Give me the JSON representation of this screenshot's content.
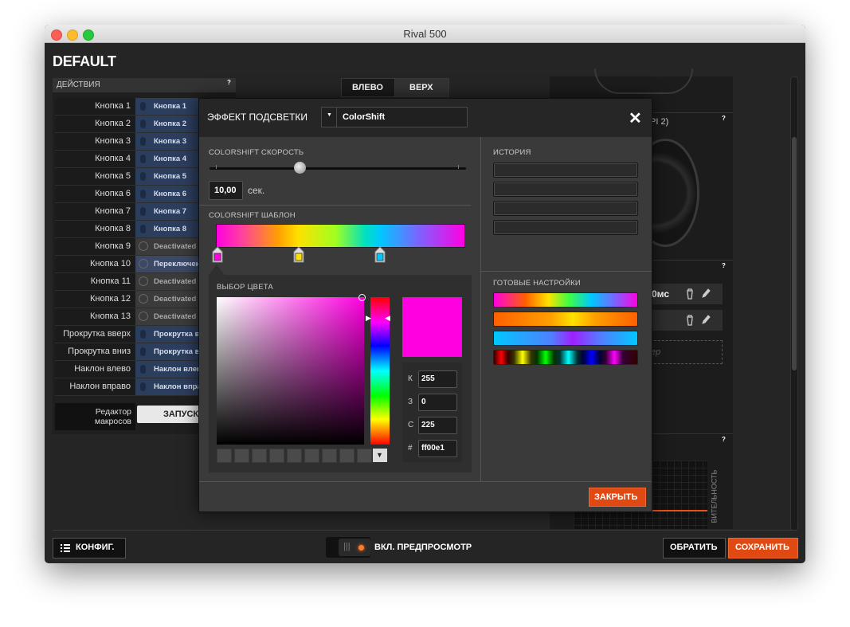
{
  "window": {
    "title": "Rival 500"
  },
  "profile": {
    "name": "DEFAULT"
  },
  "actions": {
    "header": "ДЕЙСТВИЯ",
    "help": "?",
    "rows": [
      {
        "name": "Кнопка 1",
        "value": "Кнопка 1",
        "kind": "mouse"
      },
      {
        "name": "Кнопка 2",
        "value": "Кнопка 2",
        "kind": "mouse"
      },
      {
        "name": "Кнопка 3",
        "value": "Кнопка 3",
        "kind": "mouse"
      },
      {
        "name": "Кнопка 4",
        "value": "Кнопка 4",
        "kind": "mouse"
      },
      {
        "name": "Кнопка 5",
        "value": "Кнопка 5",
        "kind": "mouse"
      },
      {
        "name": "Кнопка 6",
        "value": "Кнопка 6",
        "kind": "mouse"
      },
      {
        "name": "Кнопка 7",
        "value": "Кнопка 7",
        "kind": "mouse"
      },
      {
        "name": "Кнопка 8",
        "value": "Кнопка 8",
        "kind": "mouse"
      },
      {
        "name": "Кнопка 9",
        "value": "Deactivated",
        "kind": "off"
      },
      {
        "name": "Кнопка 10",
        "value": "Переключен",
        "kind": "switch"
      },
      {
        "name": "Кнопка 11",
        "value": "Deactivated",
        "kind": "off"
      },
      {
        "name": "Кнопка 12",
        "value": "Deactivated",
        "kind": "off"
      },
      {
        "name": "Кнопка 13",
        "value": "Deactivated",
        "kind": "off"
      },
      {
        "name": "Прокрутка вверх",
        "value": "Прокрутка в",
        "kind": "mouse"
      },
      {
        "name": "Прокрутка вниз",
        "value": "Прокрутка в",
        "kind": "mouse"
      },
      {
        "name": "Наклон влево",
        "value": "Наклон влев",
        "kind": "mouse"
      },
      {
        "name": "Наклон вправо",
        "value": "Наклон впра",
        "kind": "mouse"
      }
    ],
    "macro_editor": "Редактор макросов",
    "macro_launch": "ЗАПУСК"
  },
  "view_tabs": [
    "ВЛЕВО",
    "ВЕРХ"
  ],
  "background": {
    "dpi_fragment": "PI 2)",
    "delay_fragment": "0мс",
    "placeholder_fragment": "ер",
    "sensitivity_fragment": "ВИТЕЛЬНОСТЬ",
    "help": "?"
  },
  "dialog": {
    "title": "ЭФФЕКТ ПОДСВЕТКИ",
    "effect_value": "ColorShift",
    "close_glyph": "✕",
    "speed": {
      "label": "COLORSHIFT СКОРОСТЬ",
      "value": "10,00",
      "unit": "сек.",
      "position": 0.35
    },
    "template": {
      "label": "COLORSHIFT ШАБЛОН",
      "stops": [
        "#ff00e1",
        "#ffe100",
        "#00c8ff"
      ]
    },
    "picker": {
      "label": "ВЫБОР ЦВЕТА",
      "hex_color": "#ff00e1",
      "fields": [
        {
          "label": "К",
          "value": "255"
        },
        {
          "label": "З",
          "value": "0"
        },
        {
          "label": "С",
          "value": "225"
        },
        {
          "label": "#",
          "value": "ff00e1"
        }
      ]
    },
    "history": {
      "label": "ИСТОРИЯ"
    },
    "presets": {
      "label": "ГОТОВЫЕ НАСТРОЙКИ"
    },
    "close_button": "ЗАКРЫТЬ"
  },
  "bottom": {
    "config": "КОНФИГ.",
    "preview": "ВКЛ. ПРЕДПРОСМОТР",
    "revert": "ОБРАТИТЬ",
    "save": "СОХРАНИТЬ"
  },
  "colors": {
    "accent": "#ee4a10",
    "selected": "#ff00e1"
  }
}
